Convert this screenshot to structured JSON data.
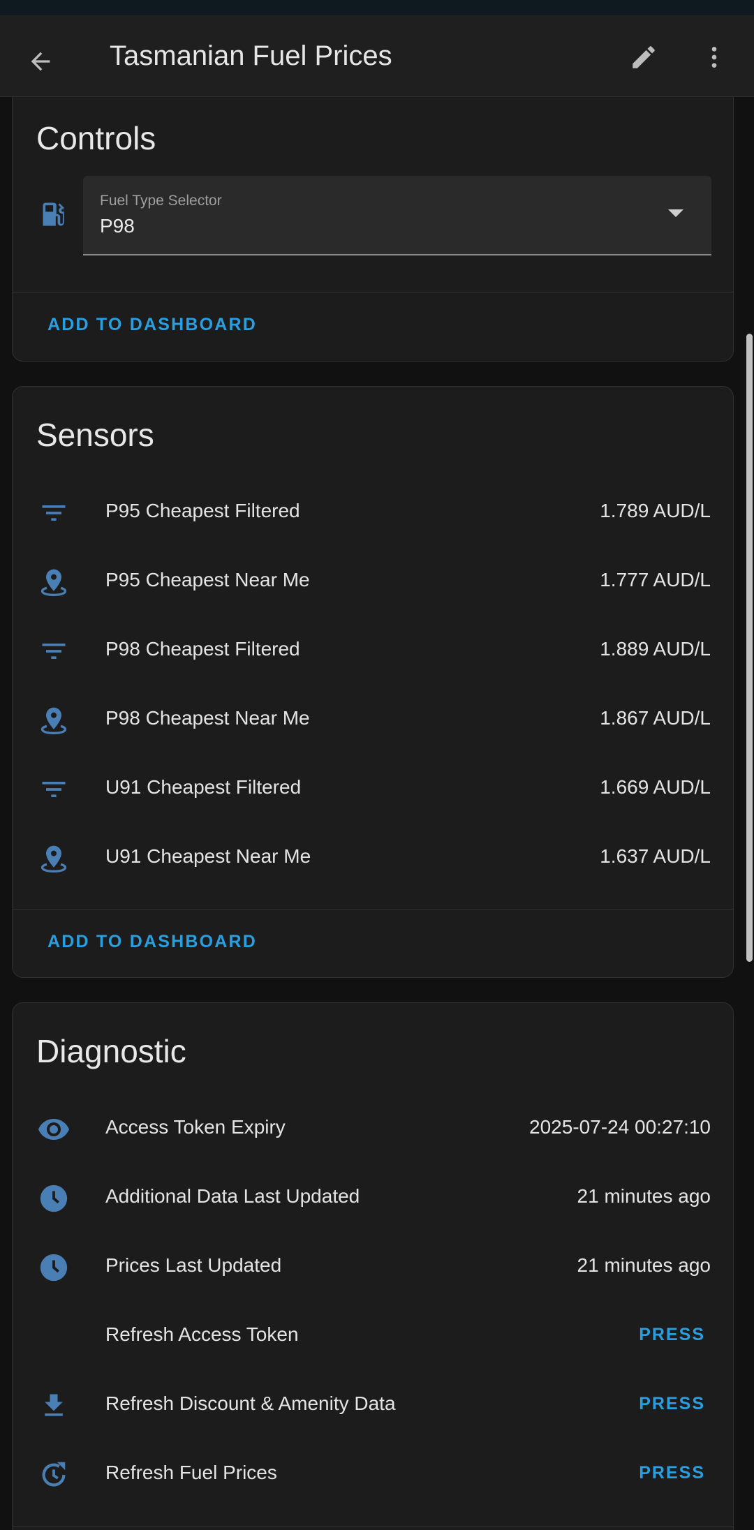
{
  "header": {
    "title": "Tasmanian Fuel Prices",
    "back_icon": "arrow-left-icon",
    "edit_icon": "pencil-icon",
    "more_icon": "dots-vertical-icon"
  },
  "controls": {
    "title": "Controls",
    "select": {
      "label": "Fuel Type Selector",
      "value": "P98",
      "icon": "gas-station-icon"
    },
    "action": "ADD TO DASHBOARD"
  },
  "sensors": {
    "title": "Sensors",
    "items": [
      {
        "icon": "filter-icon",
        "name": "P95 Cheapest Filtered",
        "value": "1.789 AUD/L"
      },
      {
        "icon": "map-marker-icon",
        "name": "P95 Cheapest Near Me",
        "value": "1.777 AUD/L"
      },
      {
        "icon": "filter-icon",
        "name": "P98 Cheapest Filtered",
        "value": "1.889 AUD/L"
      },
      {
        "icon": "map-marker-icon",
        "name": "P98 Cheapest Near Me",
        "value": "1.867 AUD/L"
      },
      {
        "icon": "filter-icon",
        "name": "U91 Cheapest Filtered",
        "value": "1.669 AUD/L"
      },
      {
        "icon": "map-marker-icon",
        "name": "U91 Cheapest Near Me",
        "value": "1.637 AUD/L"
      }
    ],
    "action": "ADD TO DASHBOARD"
  },
  "diagnostic": {
    "title": "Diagnostic",
    "items": [
      {
        "icon": "eye-icon",
        "name": "Access Token Expiry",
        "value": "2025-07-24 00:27:10"
      },
      {
        "icon": "clock-icon",
        "name": "Additional Data Last Updated",
        "value": "21 minutes ago"
      },
      {
        "icon": "clock-icon",
        "name": "Prices Last Updated",
        "value": "21 minutes ago"
      },
      {
        "icon": "",
        "name": "Refresh Access Token",
        "value": "PRESS"
      },
      {
        "icon": "download-icon",
        "name": "Refresh Discount & Amenity Data",
        "value": "PRESS"
      },
      {
        "icon": "refresh-clock-icon",
        "name": "Refresh Fuel Prices",
        "value": "PRESS"
      }
    ]
  },
  "colors": {
    "accent": "#2a9fe0",
    "icon": "#4a7fb5",
    "card": "#1c1c1c",
    "background": "#111111"
  }
}
